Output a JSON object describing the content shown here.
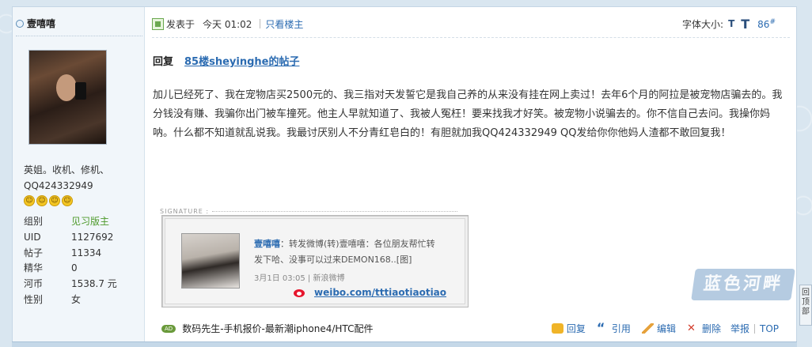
{
  "author": {
    "name": "壹嘻嘻",
    "intro_line1": "英姐。收机、修机、",
    "intro_line2": "QQ424332949",
    "stats": [
      {
        "label": "组别",
        "value": "见习版主"
      },
      {
        "label": "UID",
        "value": "1127692"
      },
      {
        "label": "帖子",
        "value": "11334"
      },
      {
        "label": "精华",
        "value": "0"
      },
      {
        "label": "河币",
        "value": "1538.7 元"
      },
      {
        "label": "性别",
        "value": "女"
      }
    ]
  },
  "post": {
    "posted_label": "发表于",
    "posted_time": "今天  01:02",
    "only_author": "只看楼主",
    "font_size_label": "字体大小:",
    "font_small": "T",
    "font_large": "T",
    "floor": "86",
    "floor_suffix": "#",
    "reply_label": "回复",
    "reply_link": "85楼sheyinghe的帖子",
    "body": "加儿已经死了、我在宠物店买2500元的、我三指对天发誓它是我自己养的从来没有挂在网上卖过！去年6个月的阿拉是被宠物店骗去的。我分钱没有赚、我骗你出门被车撞死。他主人早就知道了、我被人冤枉！要来找我才好笑。被宠物小说骗去的。你不信自己去问。我操你妈呐。什么都不知道就乱说我。我最讨厌别人不分青红皂白的！有胆就加我QQ424332949 QQ发给你你他妈人渣都不敢回复我！"
  },
  "signature": {
    "title": "SIGNATURE :",
    "name": "壹嘻嘻",
    "text": "：转发微博(转)壹嘻嘻：各位朋友帮忙转发下哈、没事可以过来DEMON168..[图]",
    "meta": "3月1日 03:05 | 新浪微博",
    "weibo_link": "weibo.com/tttiaotiaotiao"
  },
  "footer": {
    "ad_badge": "AD",
    "ad_text": "数码先生-手机报价-最新潮iphone4/HTC配件",
    "actions": {
      "reply": "回复",
      "quote": "引用",
      "edit": "编辑",
      "delete": "删除",
      "report": "举报",
      "top": "TOP"
    }
  },
  "watermark": "蓝色河畔",
  "back_top": "回顶部",
  "colors": {
    "link": "#2b6bb1",
    "group": "#4d9a2a",
    "page_bg": "#d9e6f0"
  }
}
